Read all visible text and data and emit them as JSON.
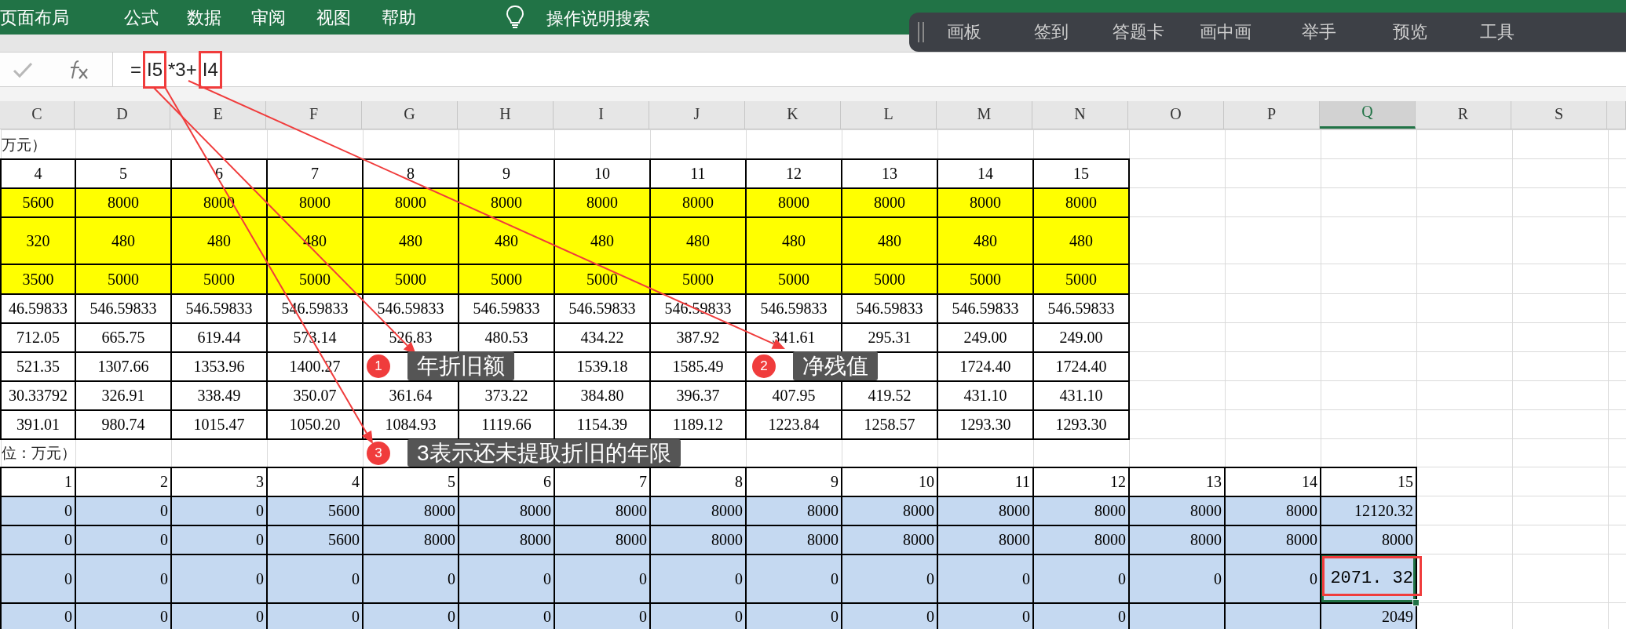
{
  "ribbon": {
    "tabs": [
      {
        "label": "页面布局",
        "selected": false
      },
      {
        "label": "公式",
        "selected": false
      },
      {
        "label": "数据",
        "selected": false
      },
      {
        "label": "审阅",
        "selected": false
      },
      {
        "label": "视图",
        "selected": false
      },
      {
        "label": "帮助",
        "selected": false
      }
    ],
    "search": {
      "label": "操作说明搜索"
    }
  },
  "floating_toolbar": {
    "items": [
      "画板",
      "签到",
      "答题卡",
      "画中画",
      "举手",
      "预览",
      "工具"
    ]
  },
  "formula_bar": {
    "formula_parts": [
      {
        "text": "=",
        "highlighted": false
      },
      {
        "text": "I5",
        "highlighted": true
      },
      {
        "text": "*3+",
        "highlighted": false
      },
      {
        "text": "I4",
        "highlighted": true
      }
    ]
  },
  "columns": [
    {
      "label": "C",
      "selected": false
    },
    {
      "label": "D",
      "selected": false
    },
    {
      "label": "E",
      "selected": false
    },
    {
      "label": "F",
      "selected": false
    },
    {
      "label": "G",
      "selected": false
    },
    {
      "label": "H",
      "selected": false
    },
    {
      "label": "I",
      "selected": false
    },
    {
      "label": "J",
      "selected": false
    },
    {
      "label": "K",
      "selected": false
    },
    {
      "label": "L",
      "selected": false
    },
    {
      "label": "M",
      "selected": false
    },
    {
      "label": "N",
      "selected": false
    },
    {
      "label": "O",
      "selected": false
    },
    {
      "label": "P",
      "selected": false
    },
    {
      "label": "Q",
      "selected": true
    },
    {
      "label": "R",
      "selected": false
    },
    {
      "label": "S",
      "selected": false
    }
  ],
  "upper_table": {
    "caption": "万元）",
    "header": [
      "4",
      "5",
      "6",
      "7",
      "8",
      "9",
      "10",
      "11",
      "12",
      "13",
      "14",
      "15"
    ],
    "rows": [
      {
        "highlighted": true,
        "cells": [
          "5600",
          "8000",
          "8000",
          "8000",
          "8000",
          "8000",
          "8000",
          "8000",
          "8000",
          "8000",
          "8000",
          "8000"
        ]
      },
      {
        "highlighted": true,
        "cells": [
          "320",
          "480",
          "480",
          "480",
          "480",
          "480",
          "480",
          "480",
          "480",
          "480",
          "480",
          "480"
        ]
      },
      {
        "highlighted": true,
        "cells": [
          "3500",
          "5000",
          "5000",
          "5000",
          "5000",
          "5000",
          "5000",
          "5000",
          "5000",
          "5000",
          "5000",
          "5000"
        ]
      },
      {
        "highlighted": false,
        "cells": [
          "46.59833",
          "546.59833",
          "546.59833",
          "546.59833",
          "546.59833",
          "546.59833",
          "546.59833",
          "546.59833",
          "546.59833",
          "546.59833",
          "546.59833",
          "546.59833"
        ]
      },
      {
        "highlighted": false,
        "cells": [
          "712.05",
          "665.75",
          "619.44",
          "573.14",
          "526.83",
          "480.53",
          "434.22",
          "387.92",
          "341.61",
          "295.31",
          "249.00",
          "249.00"
        ]
      },
      {
        "highlighted": false,
        "cells": [
          "521.35",
          "1307.66",
          "1353.96",
          "1400.27",
          null,
          null,
          "1539.18",
          "1585.49",
          null,
          null,
          "1724.40",
          "1724.40"
        ]
      },
      {
        "highlighted": false,
        "cells": [
          "30.33792",
          "326.91",
          "338.49",
          "350.07",
          "361.64",
          "373.22",
          "384.80",
          "396.37",
          "407.95",
          "419.52",
          "431.10",
          "431.10"
        ]
      },
      {
        "highlighted": false,
        "cells": [
          "391.01",
          "980.74",
          "1015.47",
          "1050.20",
          "1084.93",
          "1119.66",
          "1154.39",
          "1189.12",
          "1223.84",
          "1258.57",
          "1293.30",
          "1293.30"
        ]
      }
    ]
  },
  "lower_table": {
    "caption": "位：万元）",
    "header": [
      "1",
      "2",
      "3",
      "4",
      "5",
      "6",
      "7",
      "8",
      "9",
      "10",
      "11",
      "12",
      "13",
      "14",
      "15"
    ],
    "rows": [
      {
        "highlighted": true,
        "selected": false,
        "cells": [
          "0",
          "0",
          "0",
          "5600",
          "8000",
          "8000",
          "8000",
          "8000",
          "8000",
          "8000",
          "8000",
          "8000",
          "8000",
          "8000",
          "12120.32"
        ]
      },
      {
        "highlighted": true,
        "selected": false,
        "cells": [
          "0",
          "0",
          "0",
          "5600",
          "8000",
          "8000",
          "8000",
          "8000",
          "8000",
          "8000",
          "8000",
          "8000",
          "8000",
          "8000",
          "8000"
        ]
      },
      {
        "highlighted": true,
        "selected": true,
        "cells": [
          "0",
          "0",
          "0",
          "0",
          "0",
          "0",
          "0",
          "0",
          "0",
          "0",
          "0",
          "0",
          "0",
          "0",
          "2071. 32"
        ]
      },
      {
        "highlighted": true,
        "selected": false,
        "cells": [
          "0",
          "0",
          "0",
          "0",
          "0",
          "0",
          "0",
          "0",
          "0",
          "0",
          "0",
          "0",
          null,
          null,
          "2049"
        ]
      }
    ]
  },
  "annotations": [
    {
      "number": "1",
      "text": "年折旧额"
    },
    {
      "number": "2",
      "text": "净残值"
    },
    {
      "number": "3",
      "text": "3表示还未提取折旧的年限"
    }
  ]
}
